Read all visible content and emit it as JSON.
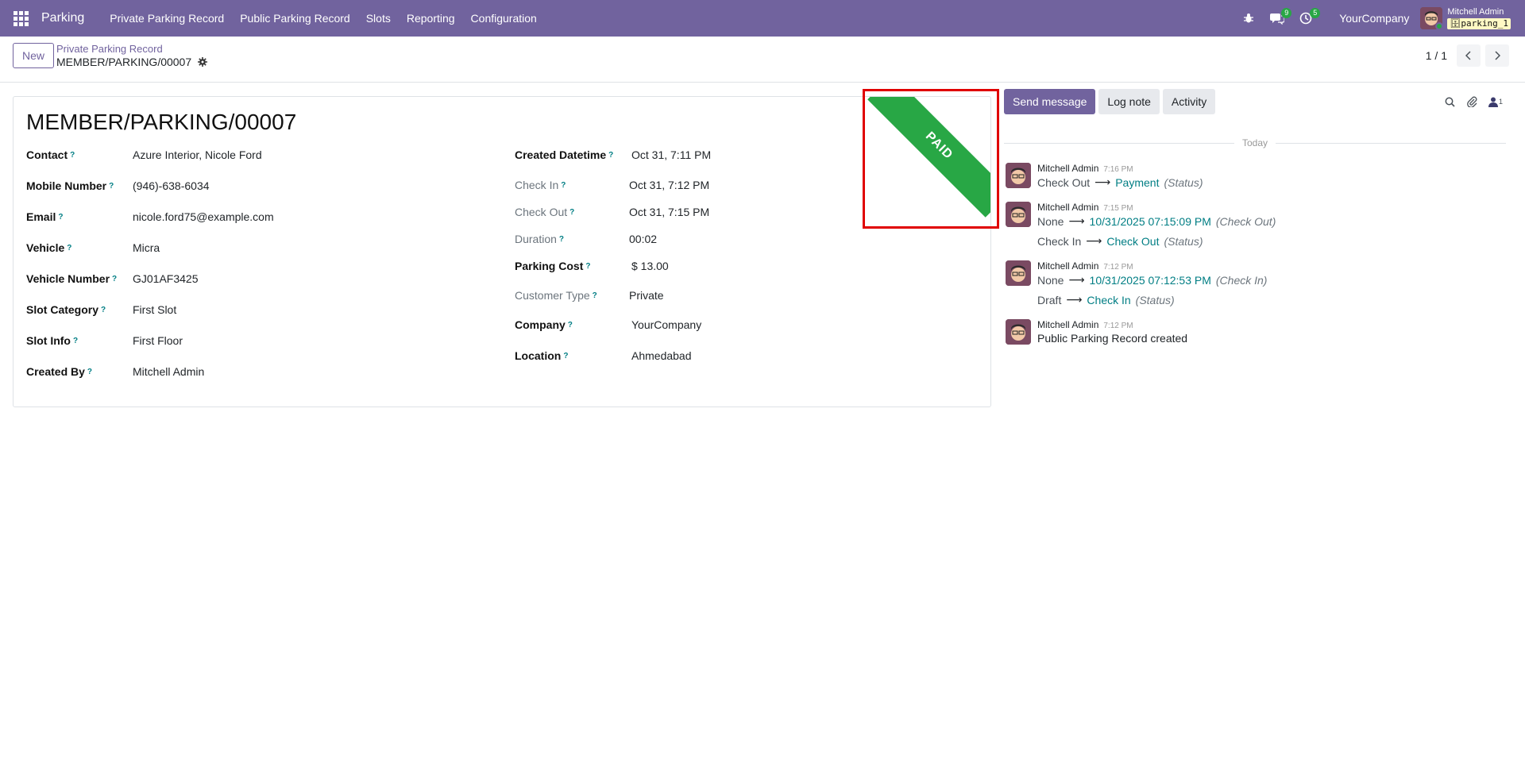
{
  "navbar": {
    "brand": "Parking",
    "menu": [
      "Private Parking Record",
      "Public Parking Record",
      "Slots",
      "Reporting",
      "Configuration"
    ],
    "messages_count": "9",
    "activities_count": "5",
    "company": "YourCompany",
    "user_name": "Mitchell Admin",
    "database": "parking_1"
  },
  "control_panel": {
    "new_label": "New",
    "breadcrumb": "Private Parking Record",
    "record_name": "MEMBER/PARKING/00007",
    "pager": "1 / 1"
  },
  "form": {
    "title": "MEMBER/PARKING/00007",
    "ribbon": "PAID",
    "left_fields": [
      {
        "label": "Contact",
        "value": "Azure Interior, Nicole Ford"
      },
      {
        "label": "Mobile Number",
        "value": "(946)-638-6034"
      },
      {
        "label": "Email",
        "value": "nicole.ford75@example.com"
      },
      {
        "label": "Vehicle",
        "value": "Micra"
      },
      {
        "label": "Vehicle Number",
        "value": "GJ01AF3425"
      },
      {
        "label": "Slot Category",
        "value": "First Slot"
      },
      {
        "label": "Slot Info",
        "value": "First Floor"
      },
      {
        "label": "Created By",
        "value": "Mitchell Admin"
      }
    ],
    "right_fields": [
      {
        "label": "Created Datetime",
        "value": "Oct 31, 7:11 PM"
      },
      {
        "label": "Check In",
        "value": "Oct 31, 7:12 PM"
      },
      {
        "label": "Check Out",
        "value": "Oct 31, 7:15 PM"
      },
      {
        "label": "Duration",
        "value": "00:02"
      },
      {
        "label": "Parking Cost",
        "value": "$ 13.00"
      },
      {
        "label": "Customer Type",
        "value": "Private"
      },
      {
        "label": "Company",
        "value": "YourCompany"
      },
      {
        "label": "Location",
        "value": "Ahmedabad"
      }
    ]
  },
  "chatter": {
    "send_message": "Send message",
    "log_note": "Log note",
    "activity": "Activity",
    "followers_count": "1",
    "today_label": "Today",
    "messages": [
      {
        "author": "Mitchell Admin",
        "time": "7:16 PM",
        "changes": [
          {
            "old": "Check Out",
            "new": "Payment",
            "field": "(Status)"
          }
        ]
      },
      {
        "author": "Mitchell Admin",
        "time": "7:15 PM",
        "changes": [
          {
            "old": "None",
            "new": "10/31/2025 07:15:09 PM",
            "field": "(Check Out)"
          },
          {
            "old": "Check In",
            "new": "Check Out",
            "field": "(Status)"
          }
        ]
      },
      {
        "author": "Mitchell Admin",
        "time": "7:12 PM",
        "changes": [
          {
            "old": "None",
            "new": "10/31/2025 07:12:53 PM",
            "field": "(Check In)"
          },
          {
            "old": "Draft",
            "new": "Check In",
            "field": "(Status)"
          }
        ]
      },
      {
        "author": "Mitchell Admin",
        "time": "7:12 PM",
        "body": "Public Parking Record created"
      }
    ]
  },
  "colors": {
    "navbar": "#71639e",
    "ribbon": "#28a745",
    "highlight": "#e00000",
    "link": "#017e84"
  }
}
